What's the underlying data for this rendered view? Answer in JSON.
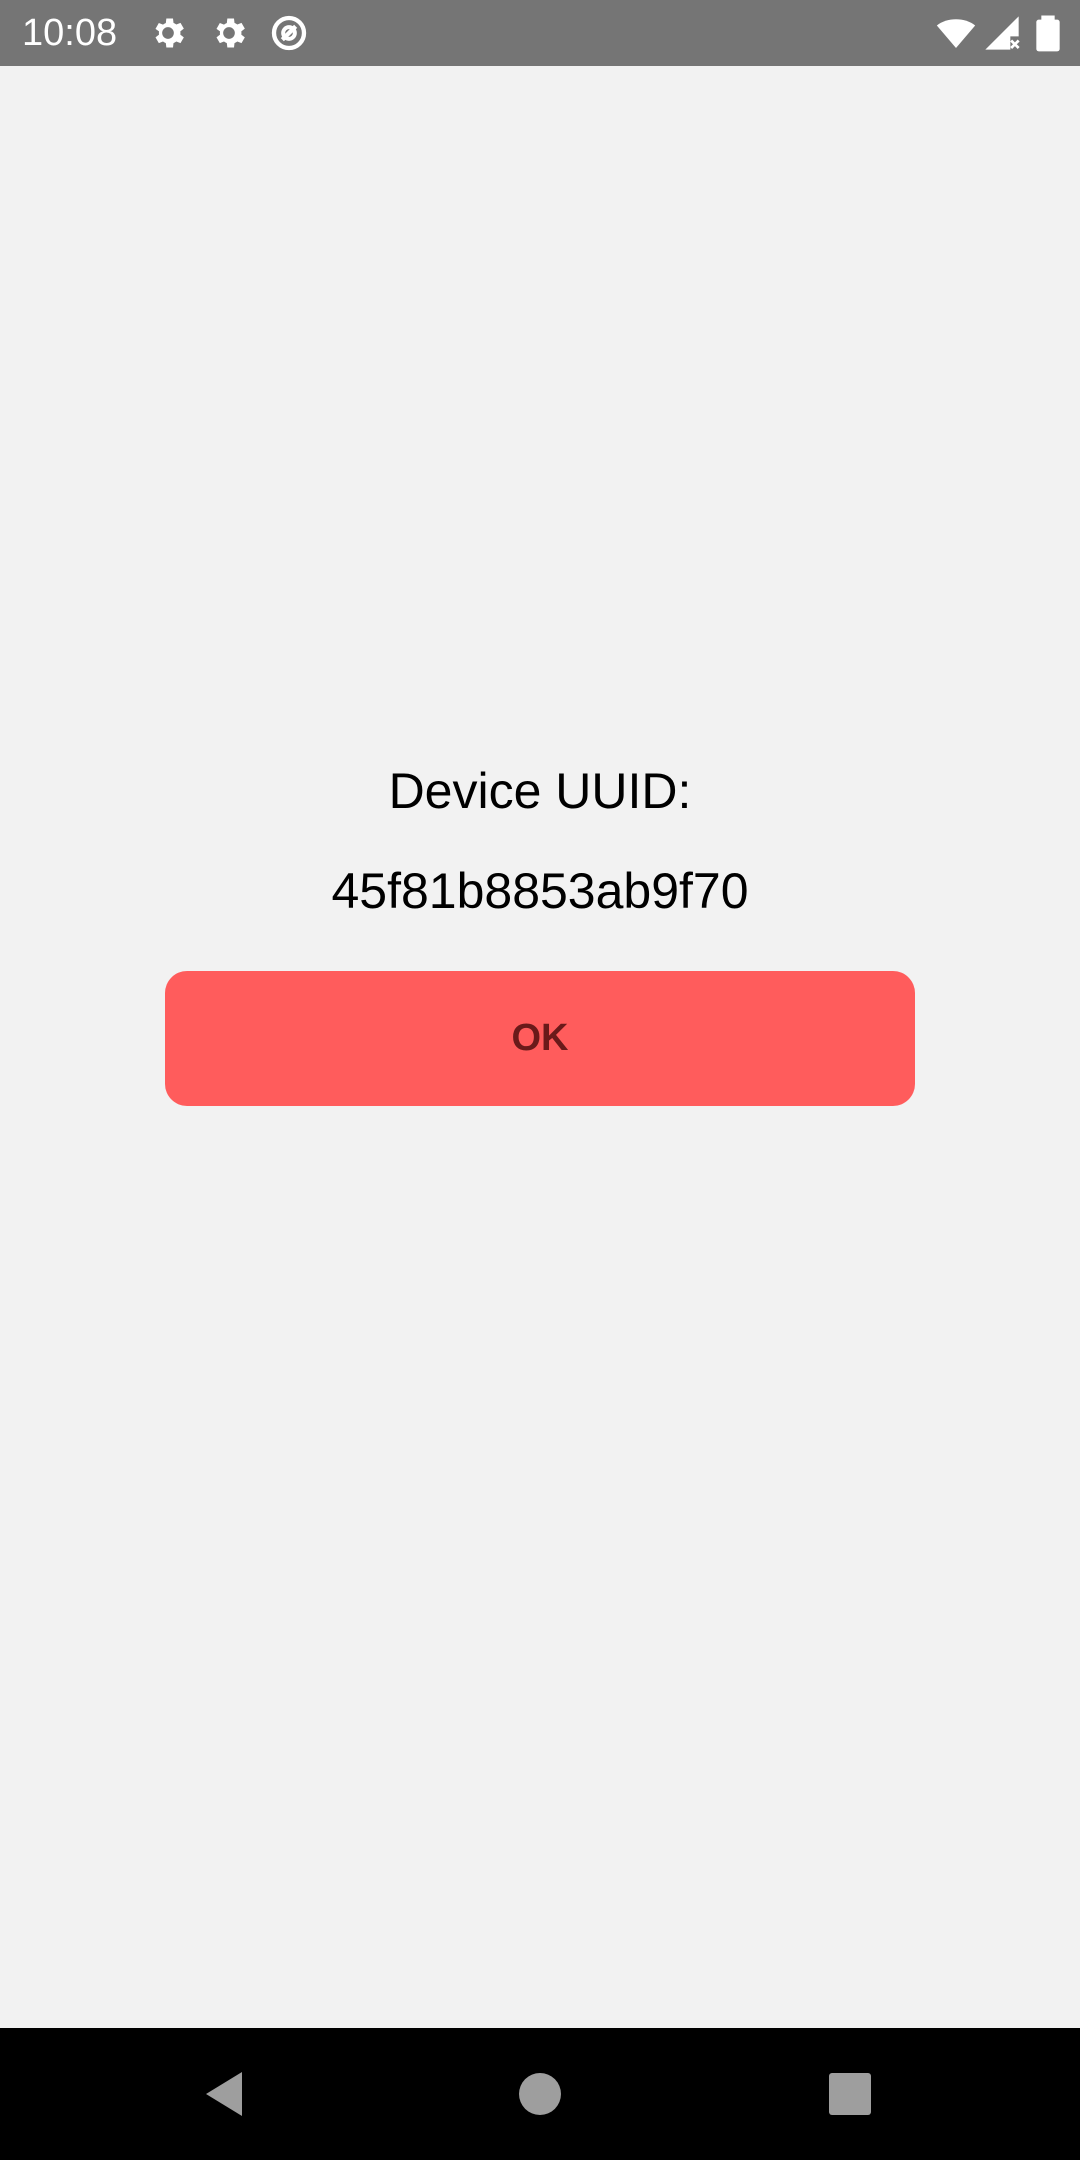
{
  "status_bar": {
    "time": "10:08",
    "icons": [
      "settings-icon",
      "settings-icon",
      "data-saver-icon",
      "wifi-icon",
      "signal-icon",
      "battery-icon"
    ],
    "color": "#757575"
  },
  "main": {
    "title": "Device UUID:",
    "uuid": "45f81b8853ab9f70",
    "ok_button_label": "OK",
    "button_color": "#ff5c5c"
  },
  "nav_bar": {
    "buttons": [
      "back-icon",
      "home-icon",
      "recents-icon"
    ]
  }
}
